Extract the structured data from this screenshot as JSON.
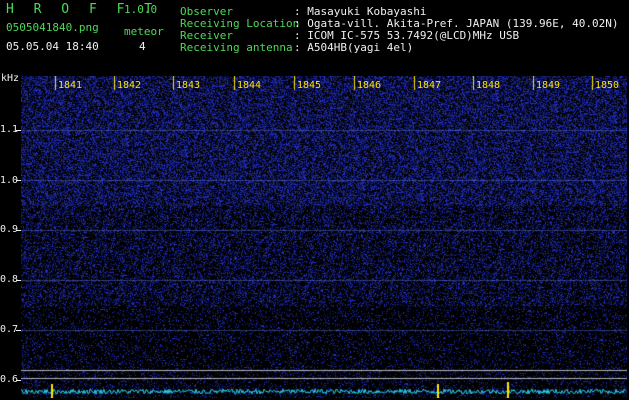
{
  "app": {
    "name": "H R O F F T",
    "version": "1.0.0",
    "filename": "0505041840.png",
    "datetime": "05.05.04 18:40",
    "meteor_label": "meteor",
    "meteor_count": "4"
  },
  "info": {
    "observer_label": "Observer",
    "observer_value": ": Masayuki Kobayashi",
    "location_label": "Receiving Location",
    "location_value": ": Ogata-vill. Akita-Pref. JAPAN (139.96E, 40.02N)",
    "receiver_label": "Receiver",
    "receiver_value": ": ICOM IC-575 53.7492(@LCD)MHz USB",
    "antenna_label": "Receiving antenna",
    "antenna_value": ": A504HB(yagi 4el)"
  },
  "axis": {
    "unit": "kHz",
    "y_ticks": [
      "1.1",
      "1.0",
      "0.9",
      "0.8",
      "0.7",
      "0.6"
    ],
    "time_labels": [
      "1841",
      "1842",
      "1843",
      "1844",
      "1845",
      "1846",
      "1847",
      "1848",
      "1849",
      "1850"
    ]
  },
  "colors": {
    "label_green": "#4dd957",
    "text_white": "#f0f0f0",
    "tick_yellow": "#ffe600",
    "noise_blue": "#2a3fd0",
    "signal_cyan": "#29d6e8"
  }
}
